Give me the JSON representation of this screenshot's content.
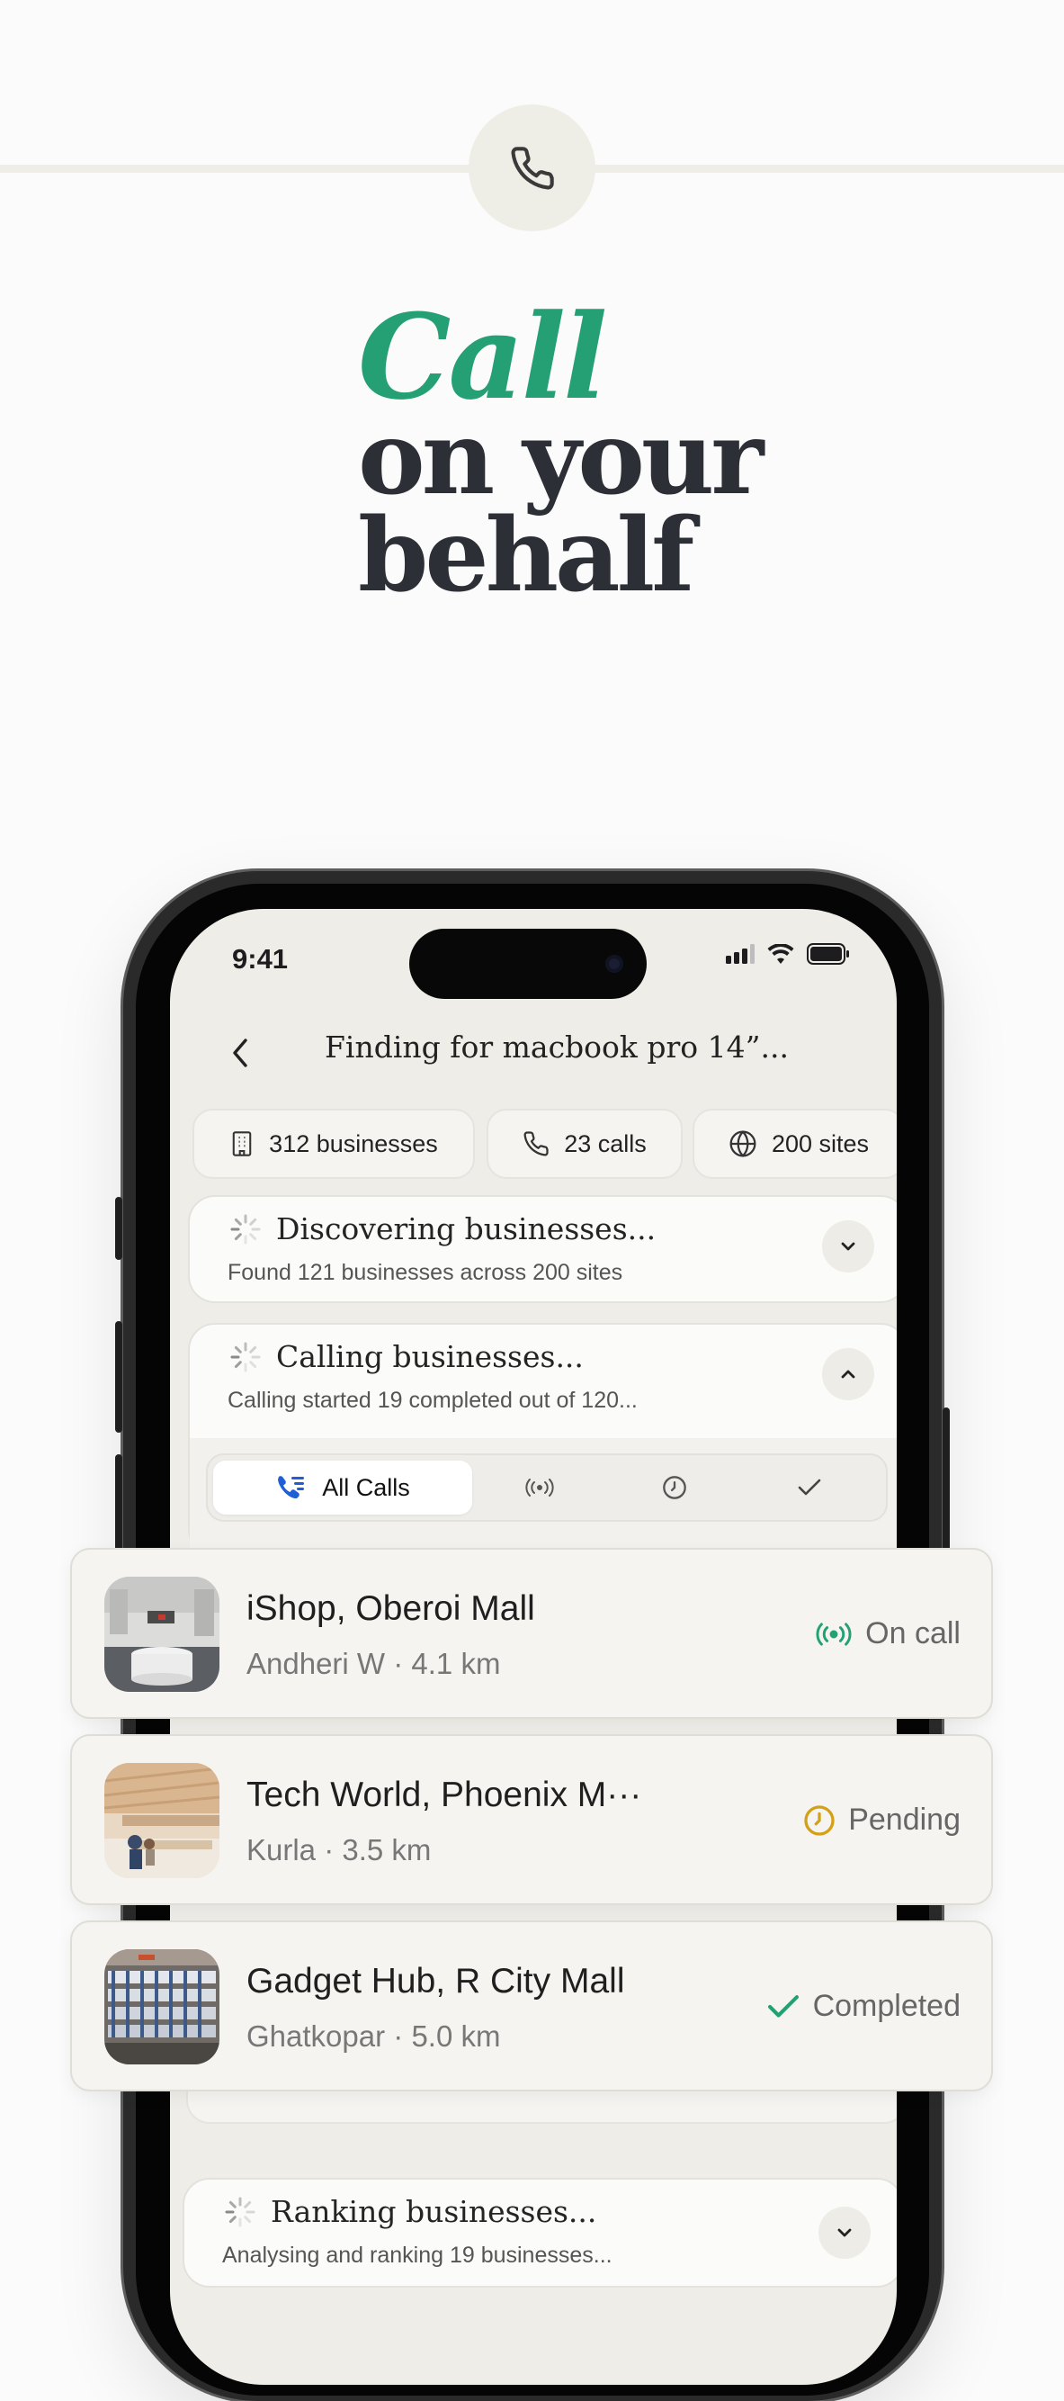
{
  "hero": {
    "icon": "phone-icon",
    "headline_accent": "Call",
    "headline_line2": "on your",
    "headline_line3": "behalf",
    "accent_color": "#24a074"
  },
  "status_bar": {
    "time": "9:41",
    "icons": [
      "signal-icon",
      "wifi-icon",
      "battery-icon"
    ]
  },
  "nav": {
    "back_icon": "chevron-left-icon",
    "title": "Finding for macbook pro 14”..."
  },
  "stats": [
    {
      "icon": "building-icon",
      "label": "312 businesses"
    },
    {
      "icon": "phone-icon",
      "label": "23 calls"
    },
    {
      "icon": "globe-icon",
      "label": "200 sites"
    }
  ],
  "steps": {
    "discovering": {
      "title": "Discovering businesses...",
      "subtitle": "Found 121 businesses across 200 sites",
      "expanded": false
    },
    "calling": {
      "title": "Calling businesses...",
      "subtitle": "Calling started 19 completed out of 120...",
      "expanded": true
    },
    "ranking": {
      "title": "Ranking businesses...",
      "subtitle": "Analysing and ranking 19 businesses...",
      "expanded": false
    }
  },
  "call_tabs": {
    "all_label": "All Calls",
    "selected": "All Calls",
    "icon_tabs": [
      "broadcast-icon",
      "clock-icon",
      "check-icon"
    ]
  },
  "results": [
    {
      "name": "iShop, Oberoi Mall",
      "area": "Andheri W",
      "distance": "4.1 km",
      "status": "On call",
      "status_icon": "broadcast-icon",
      "status_color": "#24a074"
    },
    {
      "name": "Tech World, Phoenix M···",
      "area": "Kurla",
      "distance": "3.5 km",
      "status": "Pending",
      "status_icon": "clock-icon",
      "status_color": "#d4a017"
    },
    {
      "name": "Gadget Hub, R City Mall",
      "area": "Ghatkopar",
      "distance": "5.0 km",
      "status": "Completed",
      "status_icon": "check-icon",
      "status_color": "#24a074"
    }
  ],
  "separator": "·"
}
